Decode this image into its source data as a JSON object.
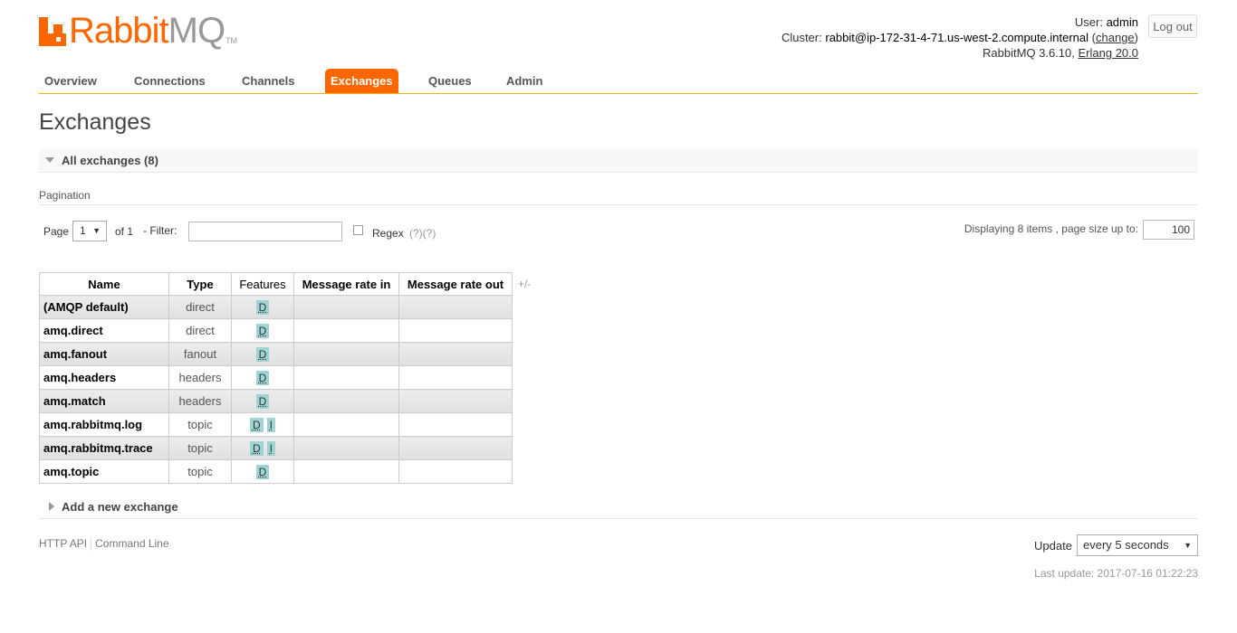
{
  "brand": {
    "rabbit": "Rabbit",
    "mq": "MQ",
    "tm": "TM"
  },
  "login": {
    "user_label": "User:",
    "user": "admin",
    "cluster_label": "Cluster:",
    "cluster": "rabbit@ip-172-31-4-71.us-west-2.compute.internal",
    "change_open": "(",
    "change_link": "change",
    "change_close": ")",
    "version": "RabbitMQ 3.6.10,",
    "erlang": "Erlang 20.0",
    "logout": "Log out"
  },
  "menu": [
    "Overview",
    "Connections",
    "Channels",
    "Exchanges",
    "Queues",
    "Admin"
  ],
  "page_title": "Exchanges",
  "section_title": "All exchanges (8)",
  "pagination": {
    "label": "Pagination",
    "page_label": "Page",
    "page_value": "1",
    "of_label": "of 1",
    "filter_label": "- Filter:",
    "filter_value": "",
    "regex_label": "Regex",
    "regex_help": "(?)(?)",
    "displaying": "Displaying 8 items , page size up to:",
    "page_size": "100"
  },
  "table": {
    "headers": [
      "Name",
      "Type",
      "Features",
      "Message rate in",
      "Message rate out"
    ],
    "plus_minus": "+/-",
    "rows": [
      {
        "name": "(AMQP default)",
        "type": "direct",
        "features": [
          "D"
        ]
      },
      {
        "name": "amq.direct",
        "type": "direct",
        "features": [
          "D"
        ]
      },
      {
        "name": "amq.fanout",
        "type": "fanout",
        "features": [
          "D"
        ]
      },
      {
        "name": "amq.headers",
        "type": "headers",
        "features": [
          "D"
        ]
      },
      {
        "name": "amq.match",
        "type": "headers",
        "features": [
          "D"
        ]
      },
      {
        "name": "amq.rabbitmq.log",
        "type": "topic",
        "features": [
          "D",
          "I"
        ]
      },
      {
        "name": "amq.rabbitmq.trace",
        "type": "topic",
        "features": [
          "D",
          "I"
        ]
      },
      {
        "name": "amq.topic",
        "type": "topic",
        "features": [
          "D"
        ]
      }
    ]
  },
  "add_exchange": "Add a new exchange",
  "footer": {
    "http_api": "HTTP API",
    "command_line": "Command Line",
    "update_label": "Update",
    "update_value": "every 5 seconds",
    "last_update": "Last update: 2017-07-16 01:22:23"
  },
  "colors": {
    "accent": "#ff6600",
    "menu_rule": "#f2b21c",
    "badge": "#9fd4d4"
  }
}
